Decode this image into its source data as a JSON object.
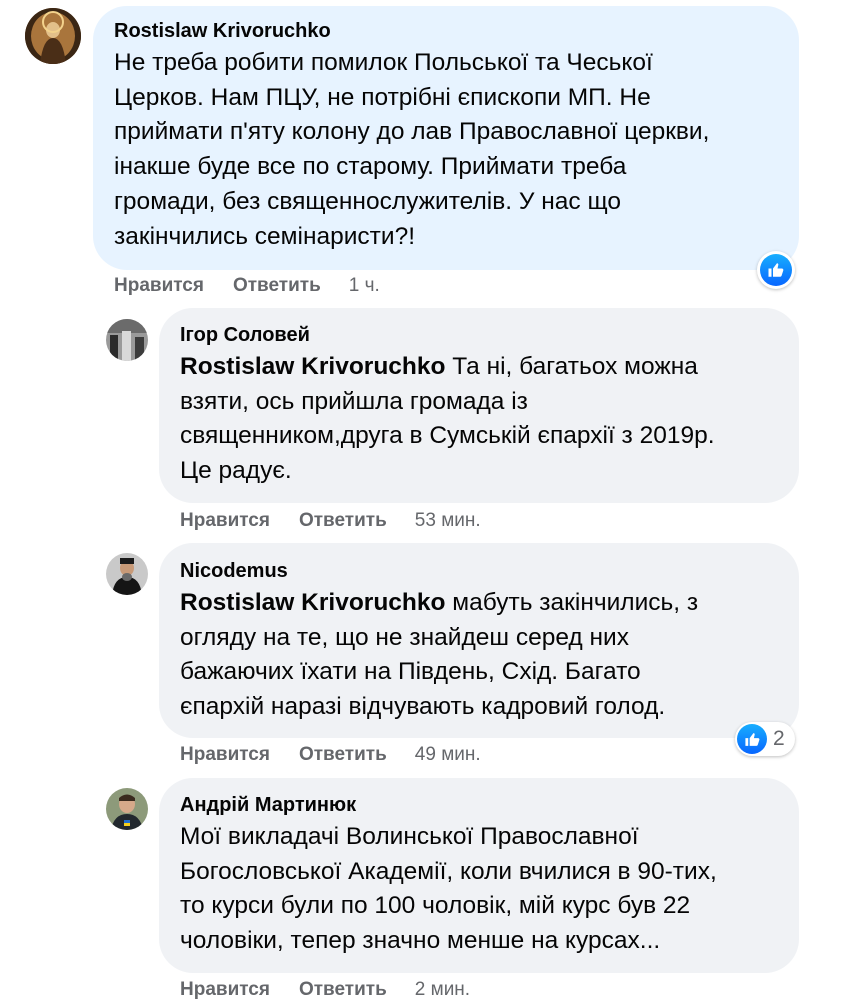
{
  "comments": [
    {
      "author": "Rostislaw Krivoruchko",
      "lines": [
        "Не треба робити помилок Польської та Чеської",
        "Церков. Нам ПЦУ, не потрібні єпископи МП. Не",
        "приймати п'яту колону до лав Православної церкви,",
        "інакше буде все по старому. Приймати треба",
        "громади, без священнослужителів. У нас що",
        "закінчились семінаристи?!"
      ],
      "like_label": "Нравится",
      "reply_label": "Ответить",
      "time": "1 ч.",
      "reaction_icon": "like-icon"
    },
    {
      "author": "Ігор Соловей",
      "mention": "Rostislaw Krivoruchko",
      "first_line_rest": " Та ні, багатьох можна",
      "lines": [
        "взяти, ось прийшла громада із",
        "священником,друга в Сумській єпархії з 2019р.",
        "Це радує."
      ],
      "like_label": "Нравится",
      "reply_label": "Ответить",
      "time": "53 мин."
    },
    {
      "author": "Nicodemus",
      "mention": "Rostislaw Krivoruchko",
      "first_line_rest": " мабуть закінчились, з",
      "lines": [
        "огляду на те, що не знайдеш серед них",
        "бажаючих їхати на Південь, Схід. Багато",
        "єпархій наразі відчувають кадровий голод."
      ],
      "like_label": "Нравится",
      "reply_label": "Ответить",
      "time": "49 мин.",
      "reaction_icon": "like-icon",
      "reaction_count": "2"
    },
    {
      "author": "Андрій Мартинюк",
      "lines": [
        "Мої викладачі Волинської Православної",
        "Богословської Академії, коли вчилися в 90-тих,",
        "то курси були по 100 чоловік, мій курс був 22",
        "чоловіки, тепер значно менше на курсах..."
      ],
      "like_label": "Нравится",
      "reply_label": "Ответить",
      "time": "2 мин."
    }
  ],
  "colors": {
    "main_bubble": "#e7f3ff",
    "reply_bubble": "#f0f2f5",
    "meta_text": "#65676b",
    "like_blue": "#0866ff"
  }
}
